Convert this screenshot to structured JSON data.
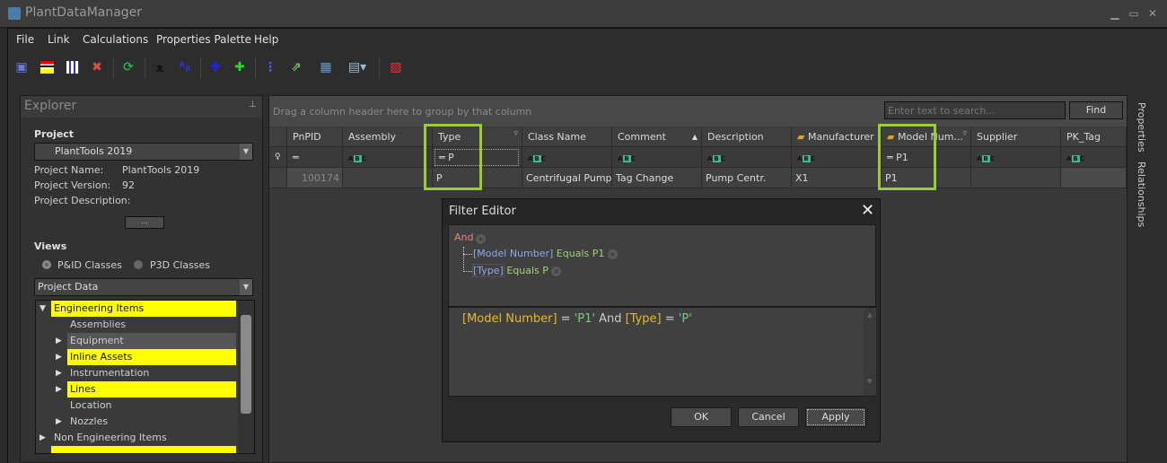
{
  "window": {
    "title": "PlantDataManager"
  },
  "menu": [
    "File",
    "Link",
    "Calculations",
    "Properties Palette",
    "Help"
  ],
  "toolbar": [
    "save-icon",
    "color-bars-icon",
    "columns-icon",
    "delete-icon",
    "refresh-icon",
    "find-icon",
    "find-replace-icon",
    "add-icon",
    "add-link-icon",
    "filter-icon",
    "export-icon",
    "import-icon",
    "grid-view-icon",
    "close-doc-icon"
  ],
  "explorer": {
    "title": "Explorer",
    "project_label": "Project",
    "project_selected": "PlantTools 2019",
    "fields": [
      {
        "label": "Project Name:",
        "value": "PlantTools 2019"
      },
      {
        "label": "Project Version:",
        "value": "92"
      },
      {
        "label": "Project Description:",
        "value": ""
      }
    ],
    "more_button": "...",
    "views_label": "Views",
    "views": [
      {
        "label": "P&ID Classes",
        "selected": true
      },
      {
        "label": "P3D Classes",
        "selected": false
      }
    ],
    "data_combo": "Project Data",
    "tree": [
      {
        "label": "Engineering Items",
        "level": 0,
        "expanded": true,
        "highlight": true
      },
      {
        "label": "Assemblies",
        "level": 1
      },
      {
        "label": "Equipment",
        "level": 1,
        "arrow": true,
        "selected": true
      },
      {
        "label": "Inline Assets",
        "level": 1,
        "arrow": true,
        "highlight": true
      },
      {
        "label": "Instrumentation",
        "level": 1,
        "arrow": true
      },
      {
        "label": "Lines",
        "level": 1,
        "arrow": true,
        "highlight": true
      },
      {
        "label": "Location",
        "level": 1
      },
      {
        "label": "Nozzles",
        "level": 1,
        "arrow": true
      },
      {
        "label": "Non Engineering Items",
        "level": 0,
        "arrow": true
      }
    ]
  },
  "grid": {
    "group_hint": "Drag a column header here to group by that column",
    "search_placeholder": "Enter text to search...",
    "find_button": "Find",
    "columns": [
      "PnPID",
      "Assembly",
      "Type",
      "Class Name",
      "Comment",
      "Description",
      "Manufacturer",
      "Model Num...",
      "Supplier",
      "PK_Tag"
    ],
    "filters": {
      "PnPID": "",
      "Type": "P",
      "Model": "P1"
    },
    "row": [
      "100174",
      "",
      "P",
      "Centrifugal Pump",
      "Tag Change",
      "Pump Centr.",
      "X1",
      "P1",
      "",
      ""
    ]
  },
  "side_tabs": [
    "Properties",
    "Relationships"
  ],
  "filter_editor": {
    "title": "Filter Editor",
    "group_op": "And",
    "conditions": [
      {
        "field": "[Model Number]",
        "op": "Equals",
        "value": "P1"
      },
      {
        "field": "[Type]",
        "op": "Equals",
        "value": "P"
      }
    ],
    "expression": {
      "f1": "[Model Number]",
      "eq1": " = ",
      "v1": "'P1'",
      "and": " And ",
      "f2": "[Type]",
      "eq2": " = ",
      "v2": "'P'"
    },
    "buttons": {
      "ok": "OK",
      "cancel": "Cancel",
      "apply": "Apply"
    }
  },
  "colors": {
    "highlight": "#ffff00",
    "accent_box": "#9acd32"
  }
}
